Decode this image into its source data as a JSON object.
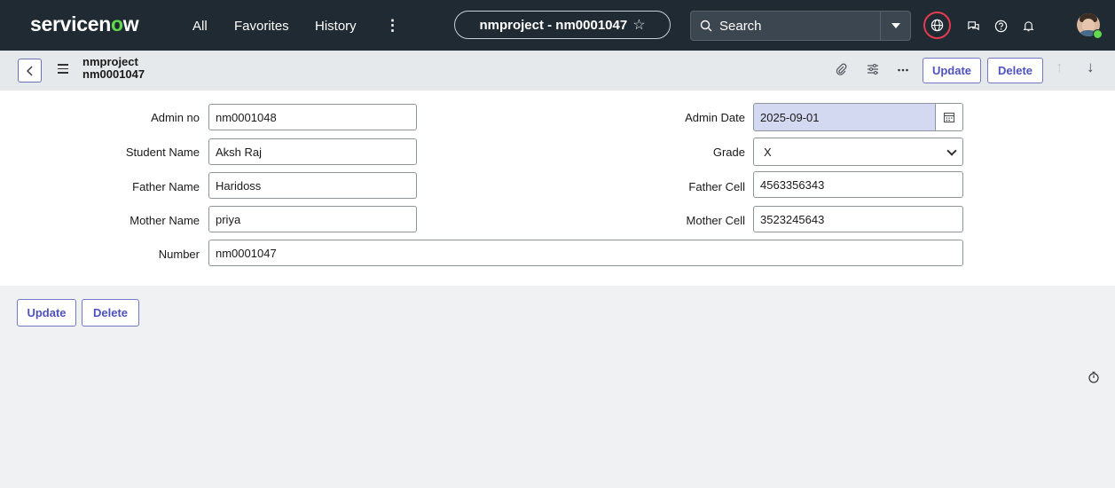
{
  "nav": {
    "logo_a": "servicen",
    "logo_o": "o",
    "logo_b": "w",
    "all": "All",
    "favorites": "Favorites",
    "history": "History",
    "more": "⋮",
    "record_pill": "nmproject - nm0001047",
    "search_label": "Search"
  },
  "header": {
    "title_line1": "nmproject",
    "title_line2": "nm0001047",
    "update_label": "Update",
    "delete_label": "Delete"
  },
  "form": {
    "admin_no": {
      "label": "Admin no",
      "value": "nm0001048"
    },
    "student_name": {
      "label": "Student Name",
      "value": "Aksh Raj"
    },
    "father_name": {
      "label": "Father Name",
      "value": "Haridoss"
    },
    "mother_name": {
      "label": "Mother Name",
      "value": "priya"
    },
    "number": {
      "label": "Number",
      "value": "nm0001047"
    },
    "admin_date": {
      "label": "Admin Date",
      "value": "2025-09-01"
    },
    "grade": {
      "label": "Grade",
      "value": "X"
    },
    "father_cell": {
      "label": "Father Cell",
      "value": "4563356343"
    },
    "mother_cell": {
      "label": "Mother Cell",
      "value": "3523245643"
    }
  },
  "footer": {
    "update_label": "Update",
    "delete_label": "Delete"
  },
  "colors": {
    "nav_bg": "#1f2a33",
    "accent": "#4f52bd",
    "logo_green": "#62d84e",
    "globe_ring": "#e33b4f",
    "date_field_bg": "#d4d9f2"
  }
}
